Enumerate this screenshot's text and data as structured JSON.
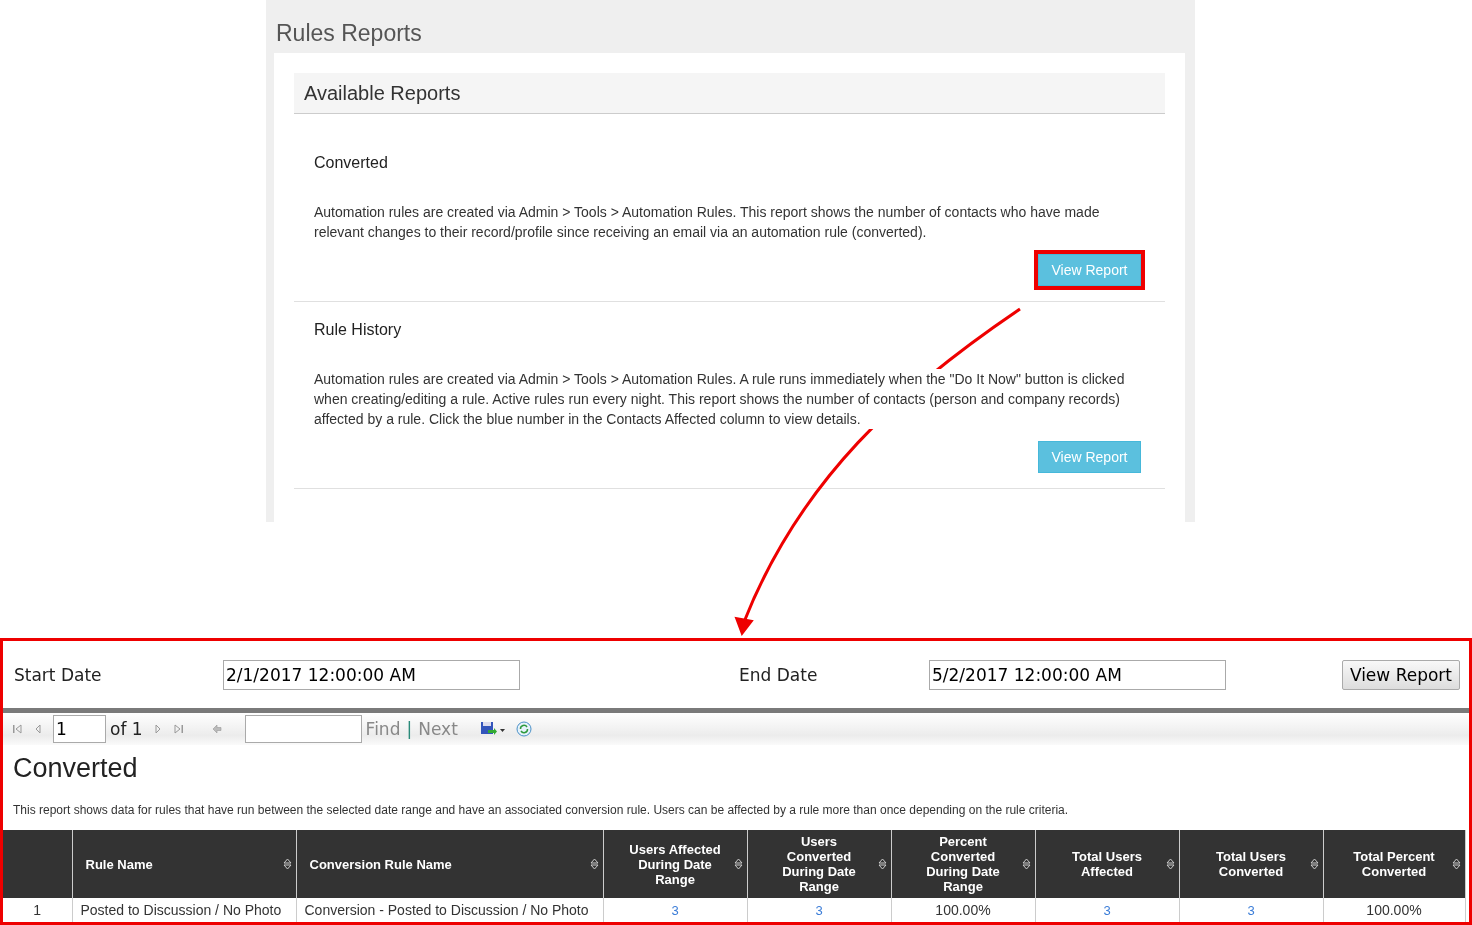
{
  "page": {
    "title": "Rules Reports"
  },
  "available_reports": {
    "heading": "Available Reports",
    "reports": [
      {
        "title": "Converted",
        "description": "Automation rules are created via Admin > Tools > Automation Rules. This report shows the number of contacts who have made relevant changes to their record/profile since receiving an email via an automation rule (converted).",
        "button": "View Report",
        "highlighted": true
      },
      {
        "title": "Rule History",
        "description": "Automation rules are created via Admin > Tools > Automation Rules. A rule runs immediately when the \"Do It Now\" button is clicked when creating/editing a rule. Active rules run every night. This report shows the number of contacts (person and company records) affected by a rule. Click the blue number in the Contacts Affected column to view details.",
        "button": "View Report",
        "highlighted": false
      }
    ]
  },
  "report_viewer": {
    "start_date_label": "Start Date",
    "start_date": "2/1/2017 12:00:00 AM",
    "end_date_label": "End Date",
    "end_date": "5/2/2017 12:00:00 AM",
    "view_button": "View Report",
    "toolbar": {
      "page": "1",
      "page_count": "of 1",
      "find": "Find",
      "separator": "|",
      "next": "Next"
    },
    "title": "Converted",
    "description": "This report shows data for rules that have run between the selected date range and have an associated conversion rule.  Users can be affected by a rule more than once depending on the rule criteria.",
    "table": {
      "columns": [
        "",
        "Rule Name",
        "Conversion Rule Name",
        "Users Affected During Date Range",
        "Users Converted During Date Range",
        "Percent Converted During Date Range",
        "Total Users Affected",
        "Total Users Converted",
        "Total Percent Converted"
      ],
      "rows": [
        {
          "cells": [
            {
              "text": "1",
              "kind": "plain"
            },
            {
              "text": "Posted to Discussion / No Photo",
              "kind": "plain"
            },
            {
              "text": "Conversion - Posted to Discussion / No Photo",
              "kind": "plain"
            },
            {
              "text": "3",
              "kind": "link"
            },
            {
              "text": "3",
              "kind": "link"
            },
            {
              "text": "100.00%",
              "kind": "plain"
            },
            {
              "text": "3",
              "kind": "link"
            },
            {
              "text": "3",
              "kind": "link"
            },
            {
              "text": "100.00%",
              "kind": "plain"
            }
          ]
        }
      ]
    }
  }
}
